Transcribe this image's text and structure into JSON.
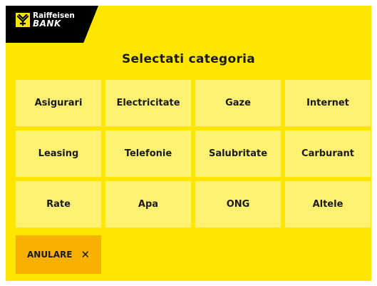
{
  "brand": {
    "line1": "Raiffeisen",
    "line2": "BANK",
    "colors": {
      "background": "#fee600",
      "tile": "#fff273",
      "cancel": "#f8b000",
      "logo_bar": "#000000"
    }
  },
  "header": {
    "title": "Selectati categoria"
  },
  "categories": [
    {
      "label": "Asigurari"
    },
    {
      "label": "Electricitate"
    },
    {
      "label": "Gaze"
    },
    {
      "label": "Internet"
    },
    {
      "label": "Leasing"
    },
    {
      "label": "Telefonie"
    },
    {
      "label": "Salubritate"
    },
    {
      "label": "Carburant"
    },
    {
      "label": "Rate"
    },
    {
      "label": "Apa"
    },
    {
      "label": "ONG"
    },
    {
      "label": "Altele"
    }
  ],
  "actions": {
    "cancel_label": "ANULARE",
    "cancel_icon": "close-icon"
  }
}
